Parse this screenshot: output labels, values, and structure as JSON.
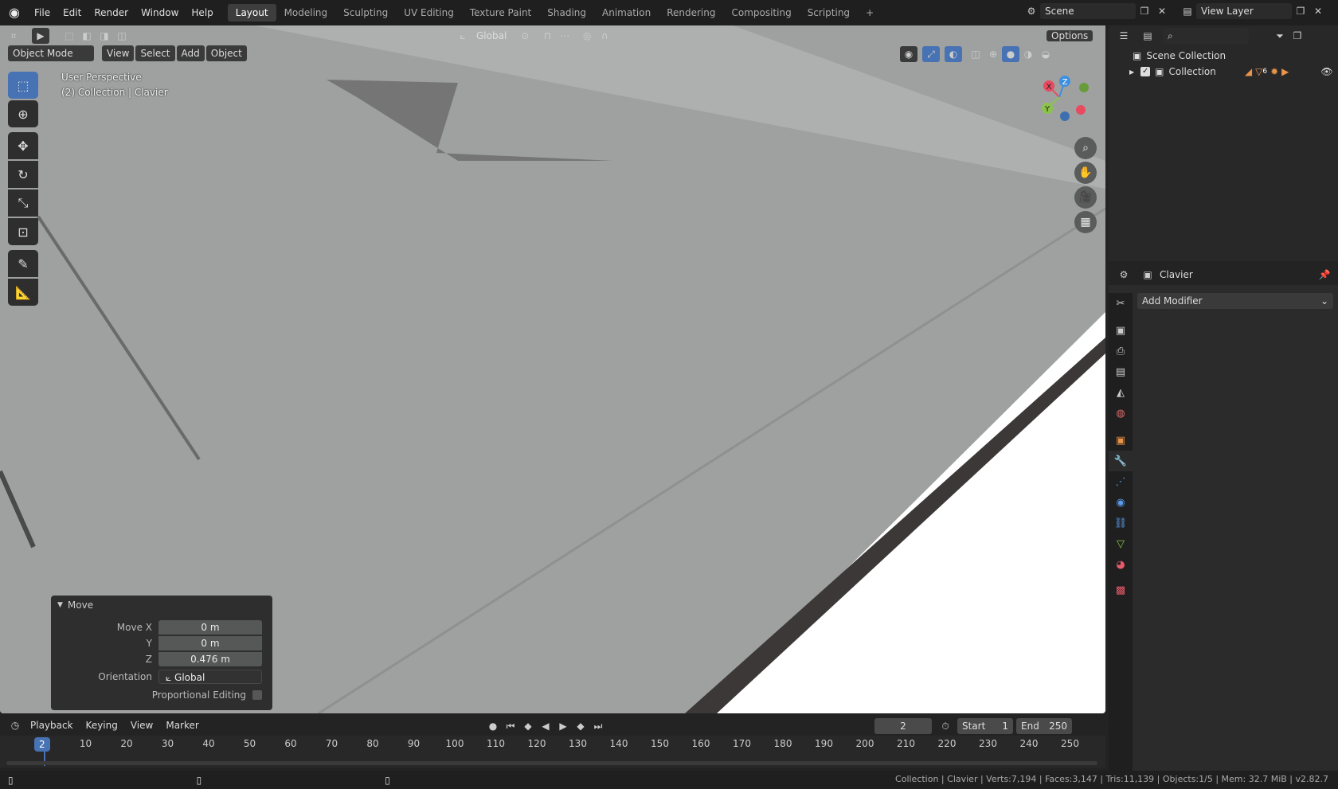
{
  "topbar": {
    "menus": [
      "File",
      "Edit",
      "Render",
      "Window",
      "Help"
    ],
    "workspaces": [
      "Layout",
      "Modeling",
      "Sculpting",
      "UV Editing",
      "Texture Paint",
      "Shading",
      "Animation",
      "Rendering",
      "Compositing",
      "Scripting"
    ],
    "add_tab": "+",
    "scene": "Scene",
    "view_layer": "View Layer"
  },
  "viewport": {
    "mode": "Object Mode",
    "menus": [
      "View",
      "Select",
      "Add",
      "Object"
    ],
    "orientation": "Global",
    "options": "Options",
    "perspective": "User Perspective",
    "collection_info": "(2) Collection | Clavier",
    "gizmo": {
      "x": "X",
      "y": "Y",
      "z": "Z"
    }
  },
  "operator_panel": {
    "title": "Move",
    "move_x_label": "Move X",
    "move_x": "0 m",
    "y_label": "Y",
    "y": "0 m",
    "z_label": "Z",
    "z": "0.476 m",
    "orientation_label": "Orientation",
    "orientation": "Global",
    "proportional_label": "Proportional Editing",
    "proportional_checked": false
  },
  "timeline": {
    "menus": [
      "Playback",
      "Keying",
      "View",
      "Marker"
    ],
    "current_frame": "2",
    "start_label": "Start",
    "start": "1",
    "end_label": "End",
    "end": "250",
    "ticks": [
      "10",
      "20",
      "30",
      "40",
      "50",
      "60",
      "70",
      "80",
      "90",
      "100",
      "110",
      "120",
      "130",
      "140",
      "150",
      "160",
      "170",
      "180",
      "190",
      "200",
      "210",
      "220",
      "230",
      "240",
      "250"
    ]
  },
  "outliner": {
    "scene_collection": "Scene Collection",
    "collection": "Collection",
    "badge_count": "6"
  },
  "properties": {
    "object_name": "Clavier",
    "add_modifier": "Add Modifier"
  },
  "statusbar": {
    "text": "Collection | Clavier | Verts:7,194 | Faces:3,147 | Tris:11,139 | Objects:1/5 | Mem: 32.7 MiB | v2.82.7"
  },
  "colors": {
    "accent": "#4772b3",
    "viewport_bg": "#9b9d9d",
    "axis_x": "#e84a5f",
    "axis_y": "#8bc34a",
    "axis_z": "#3d8fe0"
  }
}
